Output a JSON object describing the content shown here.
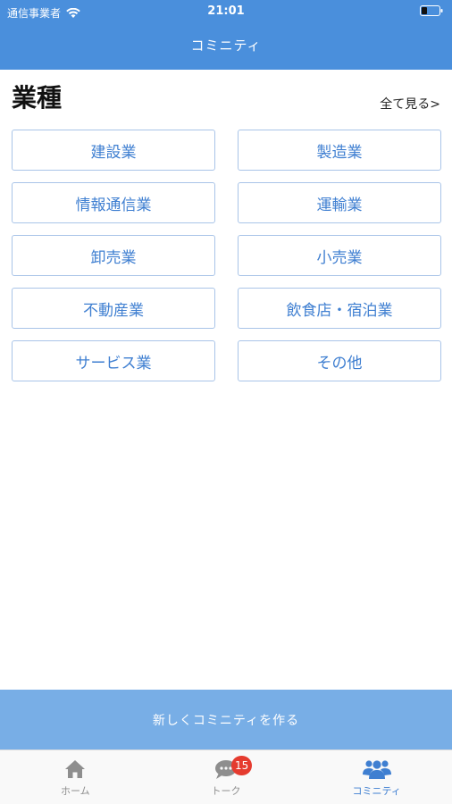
{
  "status_bar": {
    "carrier": "通信事業者",
    "time": "21:01"
  },
  "nav": {
    "title": "コミニティ"
  },
  "section": {
    "title": "業種",
    "see_all": "全て見る>"
  },
  "categories": [
    "建設業",
    "製造業",
    "情報通信業",
    "運輸業",
    "卸売業",
    "小売業",
    "不動産業",
    "飲食店・宿泊業",
    "サービス業",
    "その他"
  ],
  "create_button": "新しくコミニティを作る",
  "tabs": [
    {
      "label": "ホーム",
      "icon": "home-icon"
    },
    {
      "label": "トーク",
      "icon": "chat-icon",
      "badge": "15"
    },
    {
      "label": "コミニティ",
      "icon": "people-icon",
      "active": true
    }
  ],
  "colors": {
    "header": "#4a8fdc",
    "accent": "#3f7fd1",
    "create_bar": "#78aee6",
    "badge": "#e53b2f"
  }
}
